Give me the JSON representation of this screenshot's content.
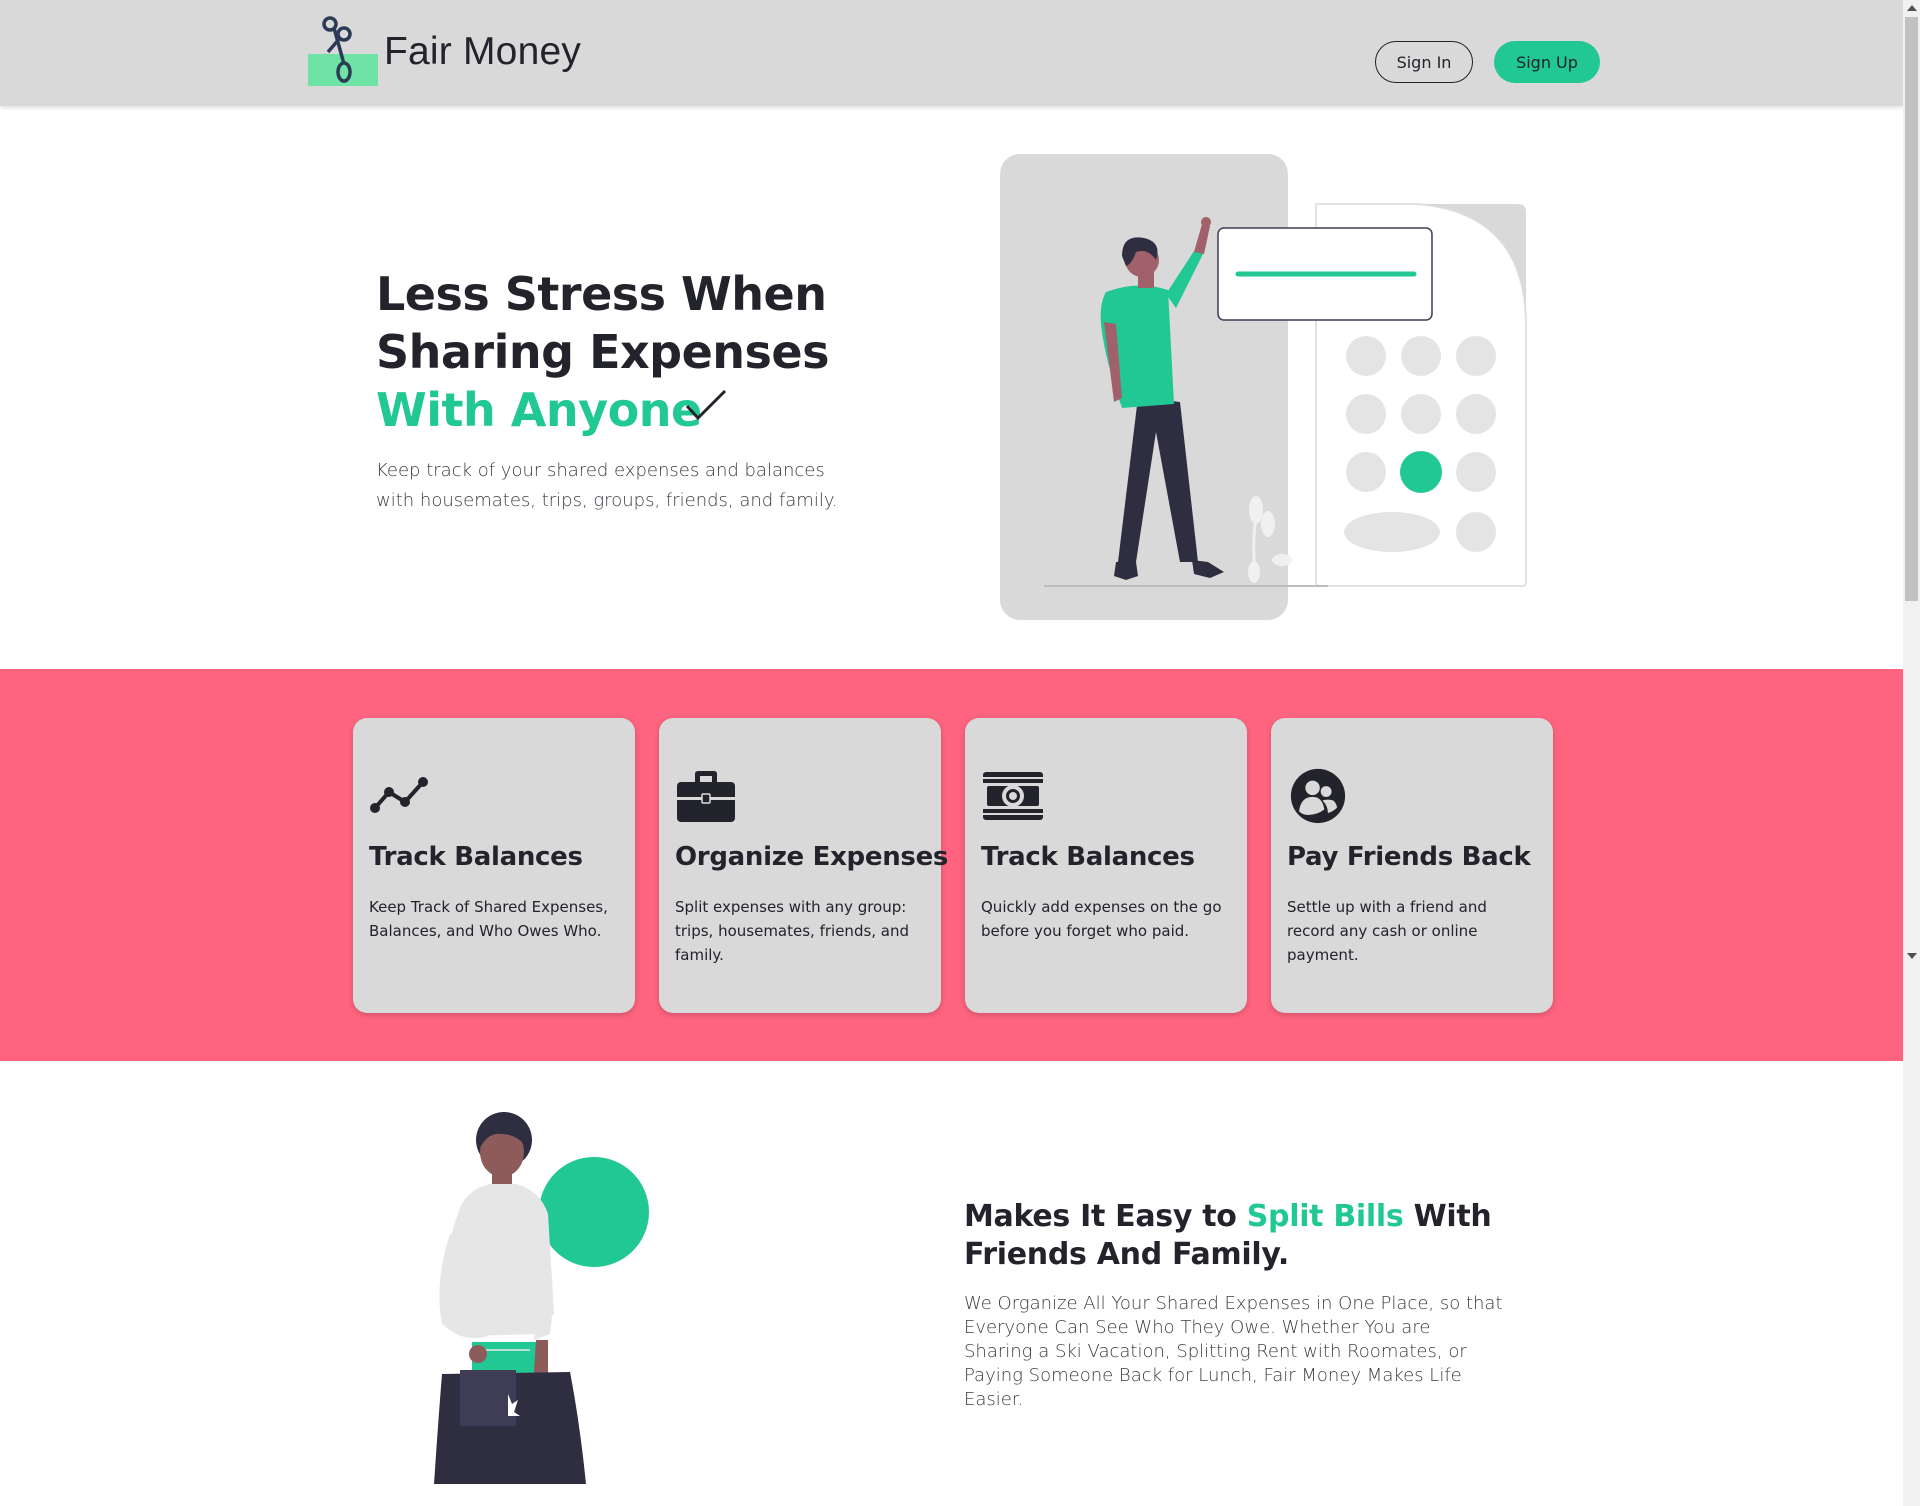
{
  "header": {
    "brand": "Fair Money",
    "sign_in": "Sign In",
    "sign_up": "Sign Up"
  },
  "hero": {
    "title_line1": "Less Stress When",
    "title_line2": "Sharing Expenses",
    "title_accent": "With Anyone",
    "subtitle": "Keep track of your shared expenses and balances with housemates, trips, groups, friends, and family."
  },
  "features": [
    {
      "icon": "trend-line-icon",
      "title": "Track Balances",
      "text": "Keep Track of Shared Expenses, Balances, and Who Owes Who."
    },
    {
      "icon": "briefcase-icon",
      "title": "Organize Expenses",
      "text": "Split expenses with any group: trips, housemates, friends, and family."
    },
    {
      "icon": "money-bill-icon",
      "title": "Track Balances",
      "text": "Quickly add expenses on the go before you forget who paid."
    },
    {
      "icon": "user-friends-icon",
      "title": "Pay Friends Back",
      "text": "Settle up with a friend and record any cash or online payment."
    }
  ],
  "split": {
    "title_part1": "Makes It Easy to ",
    "title_accent": "Split Bills",
    "title_part2": " With Friends And Family.",
    "body": "We Organize All Your Shared Expenses in One Place, so that Everyone Can See Who They Owe. Whether You are Sharing a Ski Vacation, Splitting Rent with Roomates, or Paying Someone Back for Lunch, Fair Money Makes Life Easier."
  },
  "colors": {
    "accent": "#21c894",
    "band": "#fe647f",
    "header": "#d9d9d9",
    "dark": "#22232b"
  }
}
